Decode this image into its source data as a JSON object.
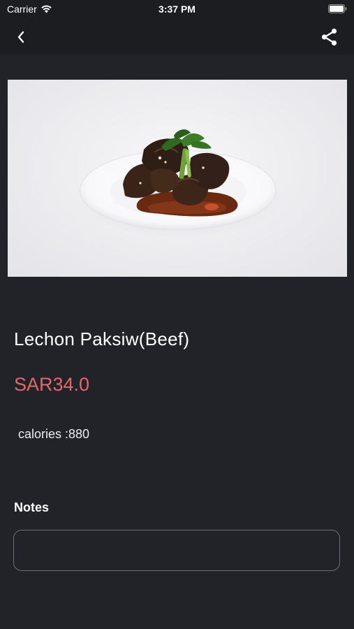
{
  "status_bar": {
    "carrier": "Carrier",
    "time": "3:37 PM",
    "wifi_icon": "wifi-icon",
    "battery_icon": "battery-icon"
  },
  "nav": {
    "back_icon": "chevron-left-icon",
    "share_icon": "share-icon"
  },
  "product": {
    "title": "Lechon Paksiw(Beef)",
    "price": "SAR34.0",
    "calories": "calories :880",
    "price_color": "#e5676a"
  },
  "notes": {
    "label": "Notes",
    "value": "",
    "placeholder": ""
  },
  "theme": {
    "background": "#222328",
    "bar_background": "#1c1d21"
  }
}
